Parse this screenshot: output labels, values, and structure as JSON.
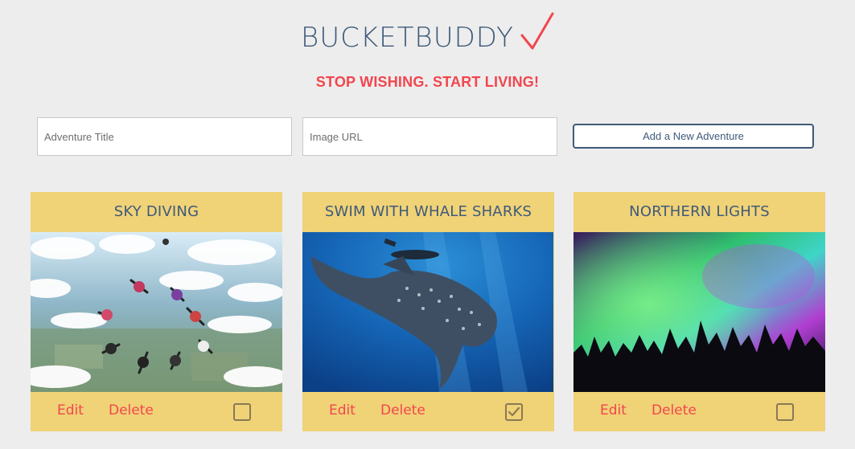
{
  "header": {
    "logo_text": "BUCKETBUDDY",
    "tagline": "STOP WISHING. START LIVING!"
  },
  "form": {
    "title_placeholder": "Adventure Title",
    "url_placeholder": "Image URL",
    "submit_label": "Add a New Adventure"
  },
  "cards": [
    {
      "title": "SKY DIVING",
      "image": "skydivers-formation-photo",
      "edit_label": "Edit",
      "delete_label": "Delete",
      "completed": false
    },
    {
      "title": "SWIM WITH WHALE SHARKS",
      "image": "whale-shark-diver-photo",
      "edit_label": "Edit",
      "delete_label": "Delete",
      "completed": true
    },
    {
      "title": "NORTHERN LIGHTS",
      "image": "aurora-forest-photo",
      "edit_label": "Edit",
      "delete_label": "Delete",
      "completed": false
    }
  ],
  "colors": {
    "background": "#ededed",
    "accent_red": "#f2464e",
    "navy": "#3e5a7a",
    "card_yellow": "#f0d277"
  }
}
